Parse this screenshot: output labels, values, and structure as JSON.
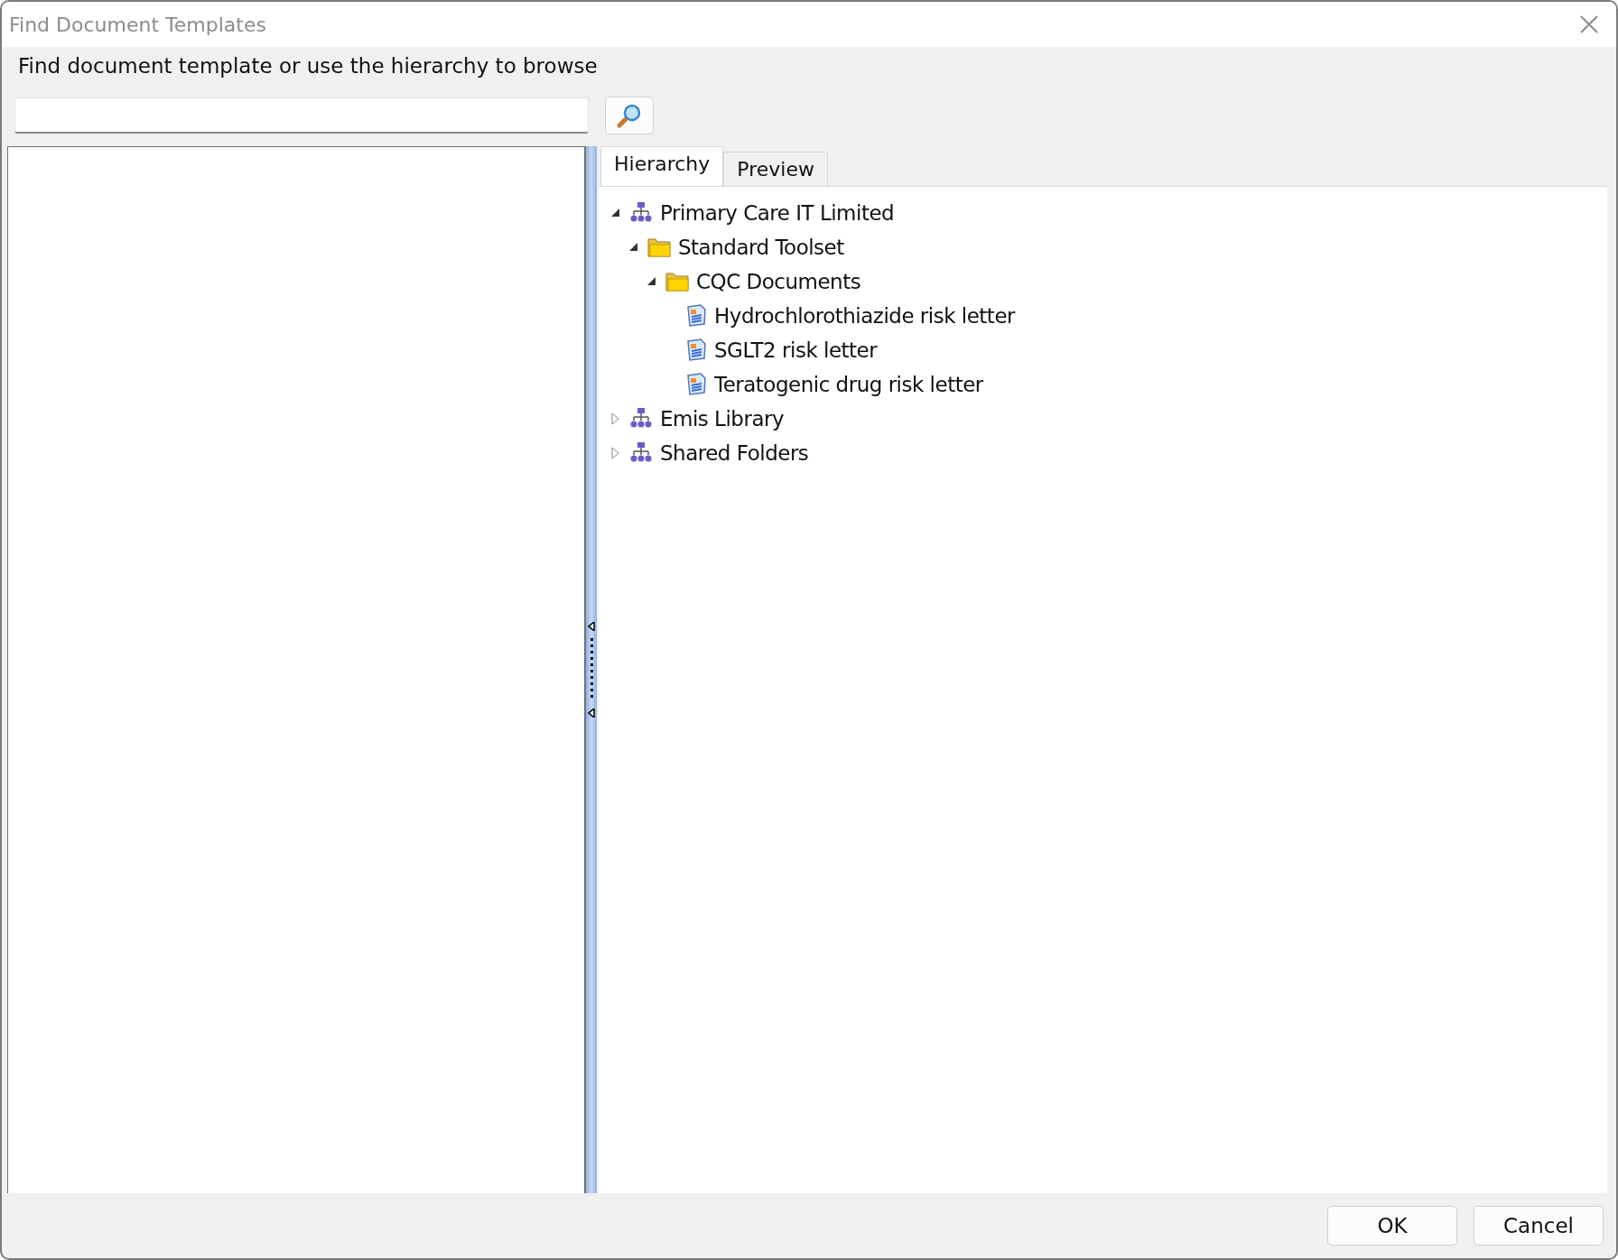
{
  "window": {
    "title": "Find Document Templates"
  },
  "prompt": "Find document template or use the hierarchy to browse",
  "tabs": [
    {
      "label": "Hierarchy",
      "selected": true
    },
    {
      "label": "Preview",
      "selected": false
    }
  ],
  "tree": [
    {
      "kind": "org",
      "label": "Primary Care IT Limited",
      "expanded": true,
      "children": [
        {
          "kind": "folder",
          "label": "Standard Toolset",
          "expanded": true,
          "children": [
            {
              "kind": "folder",
              "label": "CQC Documents",
              "expanded": true,
              "children": [
                {
                  "kind": "document",
                  "label": "Hydrochlorothiazide risk letter"
                },
                {
                  "kind": "document",
                  "label": "SGLT2 risk letter"
                },
                {
                  "kind": "document",
                  "label": "Teratogenic drug risk letter"
                }
              ]
            }
          ]
        }
      ]
    },
    {
      "kind": "org",
      "label": "Emis Library",
      "expanded": false
    },
    {
      "kind": "org",
      "label": "Shared Folders",
      "expanded": false
    }
  ],
  "buttons": [
    "OK",
    "Cancel"
  ]
}
